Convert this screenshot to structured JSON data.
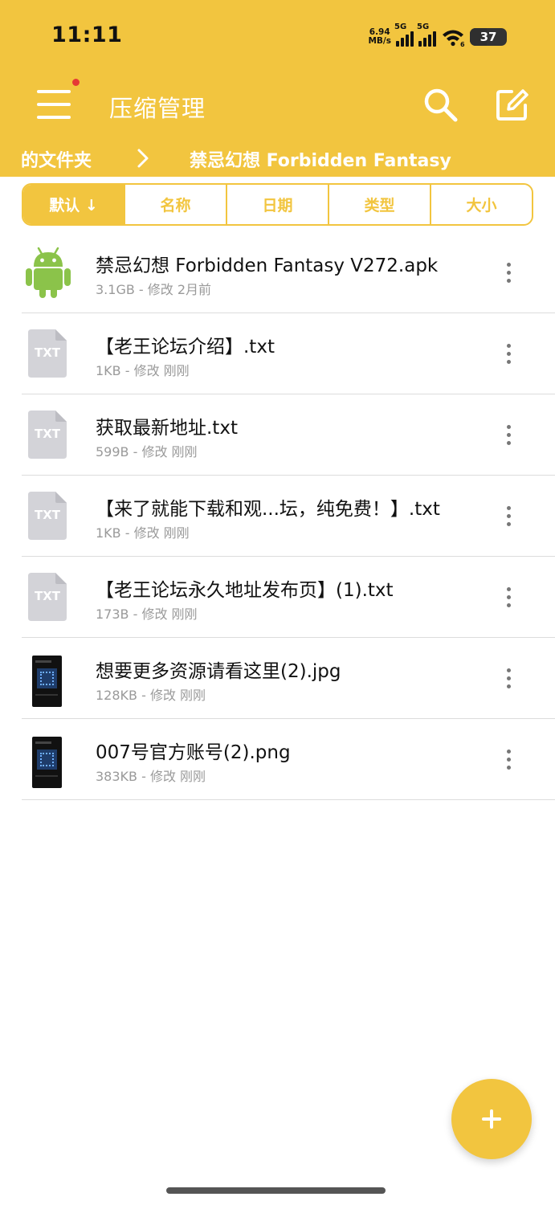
{
  "status_bar": {
    "time": "11:11",
    "speed_value": "6.94",
    "speed_unit": "MB/s",
    "signal1_label": "5G",
    "signal2_label": "5G",
    "wifi_badge": "6",
    "battery": "37"
  },
  "header": {
    "title": "压缩管理",
    "breadcrumb_prev": "的文件夹",
    "breadcrumb_current": "禁忌幻想 Forbidden Fantasy"
  },
  "sort_tabs": [
    {
      "label": "默认 ↓",
      "active": true
    },
    {
      "label": "名称",
      "active": false
    },
    {
      "label": "日期",
      "active": false
    },
    {
      "label": "类型",
      "active": false
    },
    {
      "label": "大小",
      "active": false
    }
  ],
  "files": [
    {
      "name": "禁忌幻想 Forbidden Fantasy V272.apk",
      "meta": "3.1GB - 修改 2月前",
      "icon": "android-icon"
    },
    {
      "name": "【老王论坛介绍】.txt",
      "meta": "1KB - 修改 刚刚",
      "icon": "txt-file-icon"
    },
    {
      "name": "获取最新地址.txt",
      "meta": "599B - 修改 刚刚",
      "icon": "txt-file-icon"
    },
    {
      "name": "【来了就能下载和观...坛，纯免费！】.txt",
      "meta": "1KB - 修改 刚刚",
      "icon": "txt-file-icon"
    },
    {
      "name": "【老王论坛永久地址发布页】(1).txt",
      "meta": "173B - 修改 刚刚",
      "icon": "txt-file-icon"
    },
    {
      "name": "想要更多资源请看这里(2).jpg",
      "meta": "128KB - 修改 刚刚",
      "icon": "image-thumbnail"
    },
    {
      "name": "007号官方账号(2).png",
      "meta": "383KB - 修改 刚刚",
      "icon": "image-thumbnail"
    }
  ],
  "txt_icon_label": "TXT",
  "colors": {
    "accent": "#F2C53F",
    "android_green": "#8BC34A",
    "txt_icon_gray": "#D3D3D8"
  }
}
